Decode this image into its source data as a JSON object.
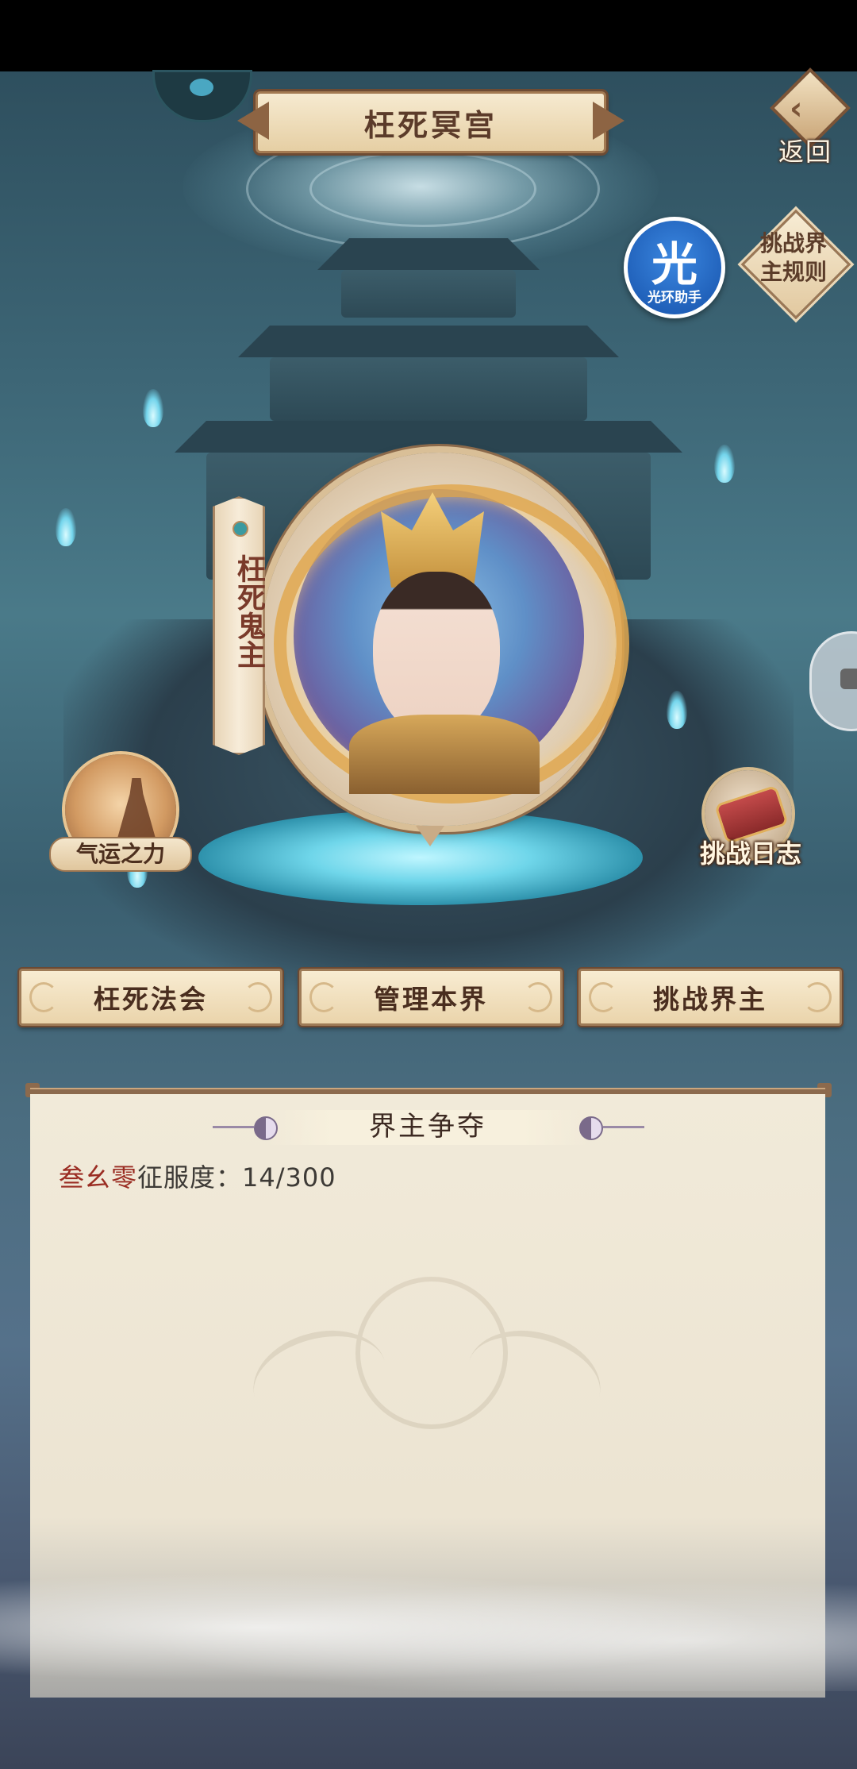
{
  "header": {
    "title": "枉死冥宫",
    "back_label": "返回",
    "back_icon": "back-arrow-icon"
  },
  "helper": {
    "glyph": "光",
    "label": "光环助手"
  },
  "rules_button": {
    "label": "挑战界主规则"
  },
  "boss": {
    "name": "枉死鬼主"
  },
  "side_features": {
    "fortune_label": "气运之力",
    "log_label": "挑战日志"
  },
  "actions": [
    {
      "label": "枉死法会"
    },
    {
      "label": "管理本界"
    },
    {
      "label": "挑战界主"
    }
  ],
  "panel": {
    "title": "界主争夺",
    "holder_name": "叁幺零",
    "conquest_label": "征服度：",
    "conquest_value": "14/300"
  },
  "colors": {
    "holder_name": "#9a2c22",
    "button_text": "#4a2e1f",
    "helper_blue": "#1f5fb8"
  }
}
